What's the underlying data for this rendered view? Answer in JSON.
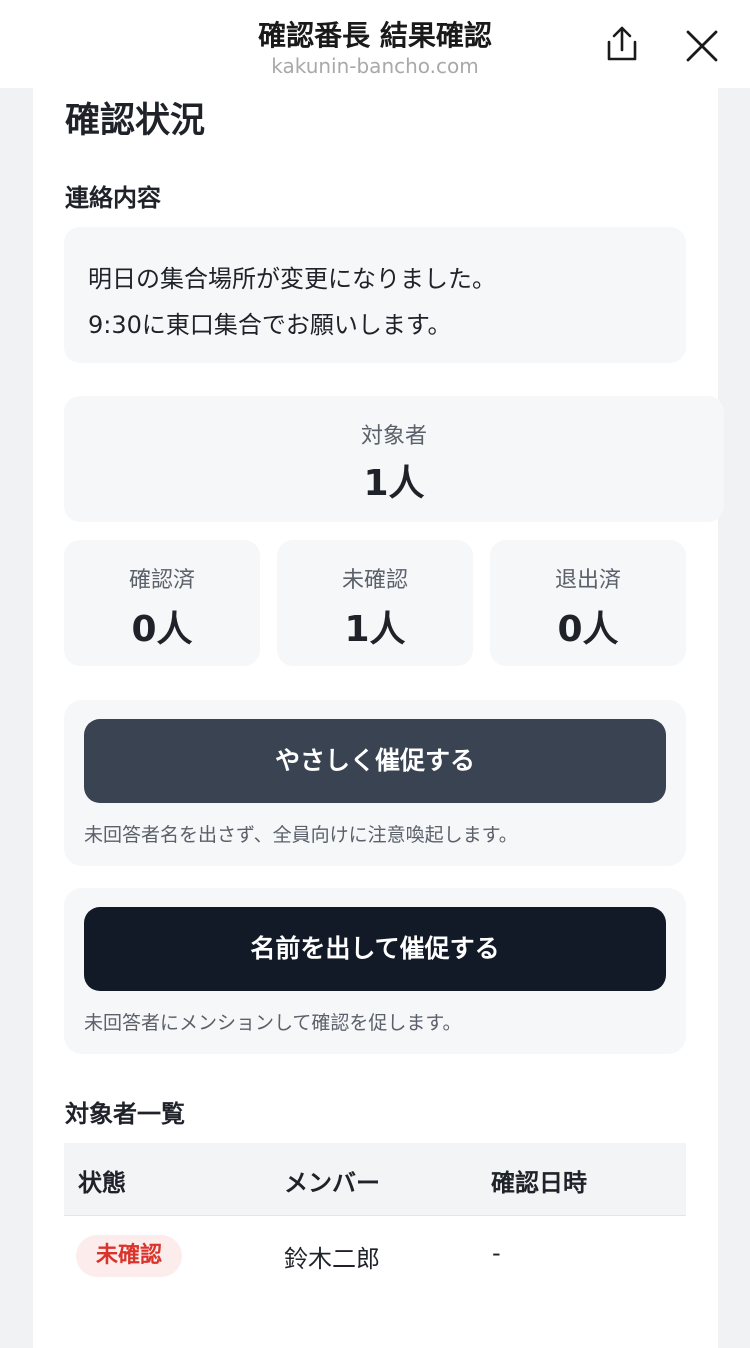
{
  "header": {
    "title": "確認番長 結果確認",
    "domain": "kakunin-bancho.com"
  },
  "page": {
    "heading": "確認状況",
    "message_section_title": "連絡内容",
    "message_lines": [
      "明日の集合場所が変更になりました。",
      "9:30に東口集合でお願いします。"
    ]
  },
  "stats": {
    "target": {
      "label": "対象者",
      "value": "1人"
    },
    "confirmed": {
      "label": "確認済",
      "value": "0人"
    },
    "unconfirmed": {
      "label": "未確認",
      "value": "1人"
    },
    "left": {
      "label": "退出済",
      "value": "0人"
    }
  },
  "actions": {
    "gentle_remind": {
      "label": "やさしく催促する",
      "note": "未回答者名を出さず、全員向けに注意喚起します。"
    },
    "named_remind": {
      "label": "名前を出して催促する",
      "note": "未回答者にメンションして確認を促します。"
    }
  },
  "member_table": {
    "title": "対象者一覧",
    "columns": [
      "状態",
      "メンバー",
      "確認日時"
    ],
    "rows": [
      {
        "status": "未確認",
        "member": "鈴木二郎",
        "confirmed_at": "-"
      }
    ]
  },
  "colors": {
    "soft_button": "#3a4352",
    "strong_button": "#131a27",
    "unconfirmed_badge_text": "#d9342b",
    "unconfirmed_badge_bg": "#fdecec"
  },
  "icons": {
    "share": "share-icon",
    "close": "close-icon"
  }
}
